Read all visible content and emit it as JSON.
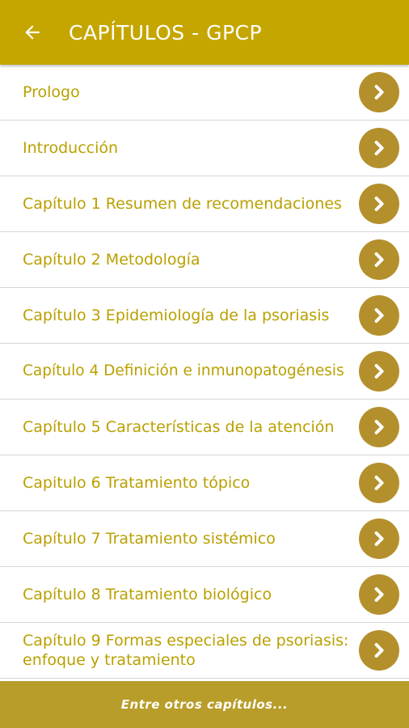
{
  "header": {
    "back_icon": "arrow-left-icon",
    "title": "CAPÍTULOS - GPCP"
  },
  "chapters": [
    {
      "label": "Prologo"
    },
    {
      "label": "Introducción"
    },
    {
      "label": "Capítulo 1 Resumen de recomendaciones"
    },
    {
      "label": "Capítulo 2 Metodología"
    },
    {
      "label": "Capítulo 3 Epidemiología de la psoriasis"
    },
    {
      "label": "Capítulo 4 Definición e inmunopatogénesis"
    },
    {
      "label": "Capítulo 5 Características de la atención"
    },
    {
      "label": "Capitulo 6 Tratamiento tópico"
    },
    {
      "label": "Capítulo 7 Tratamiento sistémico"
    },
    {
      "label": "Capítulo 8 Tratamiento biológico"
    },
    {
      "label": "Capítulo 9 Formas especiales de psoriasis: enfoque y tratamiento"
    }
  ],
  "row_icon": "chevron-right-circle-icon",
  "footer": {
    "text": "Entre otros capítulos..."
  },
  "colors": {
    "app_bar": "#c5a600",
    "text": "#b9a000",
    "chevron_circle": "#b4902c",
    "footer": "#b89d2a"
  }
}
